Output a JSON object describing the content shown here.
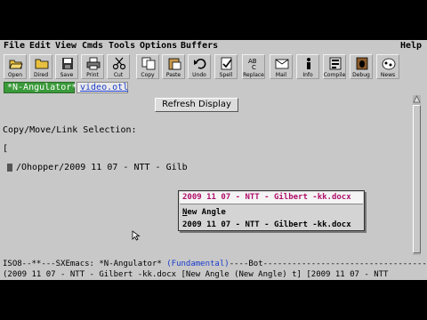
{
  "menu": {
    "file": "File",
    "edit": "Edit",
    "view": "View",
    "cmds": "Cmds",
    "tools": "Tools",
    "options": "Options",
    "buffers": "Buffers",
    "help": "Help"
  },
  "toolbar": [
    {
      "label": "Open",
      "icon": "folder-open-icon"
    },
    {
      "label": "Dired",
      "icon": "folder-icon"
    },
    {
      "label": "Save",
      "icon": "floppy-disk-icon"
    },
    {
      "label": "Print",
      "icon": "printer-icon"
    },
    {
      "label": "Cut",
      "icon": "scissors-icon"
    },
    {
      "label": "Copy",
      "icon": "copy-icon"
    },
    {
      "label": "Paste",
      "icon": "paste-icon"
    },
    {
      "label": "Undo",
      "icon": "undo-icon"
    },
    {
      "label": "Spell",
      "icon": "spell-check-icon"
    },
    {
      "label": "Replace",
      "icon": "replace-icon"
    },
    {
      "label": "Mail",
      "icon": "mail-icon"
    },
    {
      "label": "Info",
      "icon": "info-icon"
    },
    {
      "label": "Compile",
      "icon": "compile-icon"
    },
    {
      "label": "Debug",
      "icon": "debug-icon"
    },
    {
      "label": "News",
      "icon": "news-icon"
    }
  ],
  "tabs": {
    "active": "*N-Angulator*",
    "inactive": "video.otl"
  },
  "buffer": {
    "refresh_button": "Refresh Display",
    "selection_heading": "Copy/Move/Link Selection:",
    "bracket_line": "[",
    "path_line": "/Ohopper/2009 11 07 - NTT - Gilb"
  },
  "popup": {
    "title": "2009 11 07 - NTT - Gilbert -kk.docx",
    "new_angle_mnemonic": "N",
    "new_angle_rest": "ew Angle",
    "file_item": "2009 11 07 - NTT - Gilbert -kk.docx"
  },
  "modeline": {
    "left": "ISO8--**---SXEmacs: *N-Angulator*  ",
    "mode": "(Fundamental)",
    "right": "----Bot------------------------------------"
  },
  "minibuffer": "(2009 11 07 - NTT - Gilbert -kk.docx [New Angle (New Angle) t] [2009 11 07 - NTT"
}
